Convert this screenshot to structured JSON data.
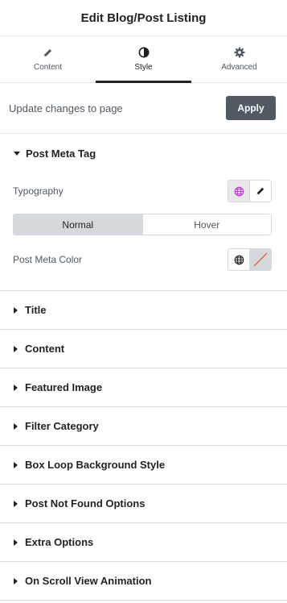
{
  "header": {
    "title": "Edit Blog/Post Listing"
  },
  "tabs": [
    {
      "label": "Content",
      "icon": "pencil-icon",
      "active": false
    },
    {
      "label": "Style",
      "icon": "contrast-icon",
      "active": true
    },
    {
      "label": "Advanced",
      "icon": "gear-icon",
      "active": false
    }
  ],
  "update": {
    "label": "Update changes to page",
    "button": "Apply"
  },
  "open_section": {
    "title": "Post Meta Tag",
    "typography_label": "Typography",
    "states": {
      "normal": "Normal",
      "hover": "Hover",
      "active": "Normal"
    },
    "color_label": "Post Meta Color"
  },
  "sections": [
    {
      "title": "Title"
    },
    {
      "title": "Content"
    },
    {
      "title": "Featured Image"
    },
    {
      "title": "Filter Category"
    },
    {
      "title": "Box Loop Background Style"
    },
    {
      "title": "Post Not Found Options"
    },
    {
      "title": "Extra Options"
    },
    {
      "title": "On Scroll View Animation"
    }
  ],
  "colors": {
    "accent_globe": "#c036d9",
    "dark": "#1f2124",
    "muted": "#515962"
  }
}
